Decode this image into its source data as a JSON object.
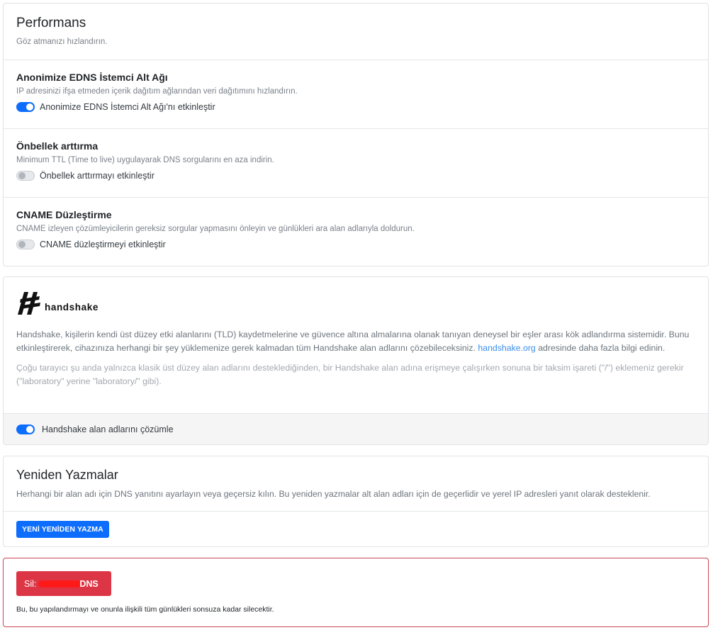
{
  "performance": {
    "title": "Performans",
    "subtitle": "Göz atmanızı hızlandırın.",
    "settings": [
      {
        "title": "Anonimize EDNS İstemci Alt Ağı",
        "description": "IP adresinizi ifşa etmeden içerik dağıtım ağlarından veri dağıtımını hızlandırın.",
        "toggle_label": "Anonimize EDNS İstemci Alt Ağı'nı etkinleştir",
        "enabled": true
      },
      {
        "title": "Önbellek arttırma",
        "description": "Minimum TTL (Time to live) uygulayarak DNS sorgularını en aza indirin.",
        "toggle_label": "Önbellek arttırmayı etkinleştir",
        "enabled": false
      },
      {
        "title": "CNAME Düzleştirme",
        "description": "CNAME izleyen çözümleyicilerin gereksiz sorgular yapmasını önleyin ve günlükleri ara alan adlarıyla doldurun.",
        "toggle_label": "CNAME düzleştirmeyi etkinleştir",
        "enabled": false
      }
    ]
  },
  "handshake": {
    "logo_text": "handshake",
    "description_before_link": "Handshake, kişilerin kendi üst düzey etki alanlarını (TLD) kaydetmelerine ve güvence altına almalarına olanak tanıyan deneysel bir eşler arası kök adlandırma sistemidir. Bunu etkinleştirerek, cihazınıza herhangi bir şey yüklemenize gerek kalmadan tüm Handshake alan adlarını çözebileceksiniz.",
    "link_text": "handshake.org",
    "description_after_link": "adresinde daha fazla bilgi edinin.",
    "note": "Çoğu tarayıcı şu anda yalnızca klasik üst düzey alan adlarını desteklediğinden, bir Handshake alan adına erişmeye çalışırken sonuna bir taksim işareti (\"/\") eklemeniz gerekir (\"laboratory\" yerine \"laboratory/\" gibi).",
    "toggle_label": "Handshake alan adlarını çözümle",
    "enabled": true
  },
  "rewrites": {
    "title": "Yeniden Yazmalar",
    "description": "Herhangi bir alan adı için DNS yanıtını ayarlayın veya geçersiz kılın. Bu yeniden yazmalar alt alan adları için de geçerlidir ve yerel IP adresleri yanıt olarak desteklenir.",
    "button_label": "YENİ YENİDEN YAZMA"
  },
  "danger": {
    "button_prefix": "Sil:",
    "button_suffix": "DNS",
    "warning": "Bu, bu yapılandırmayı ve onunla ilişkili tüm günlükleri sonsuza kadar silecektir.",
    "redaction_color": "#ff0000"
  },
  "colors": {
    "accent": "#0d6efd",
    "danger": "#dc3545",
    "link": "#3b8ee8"
  }
}
